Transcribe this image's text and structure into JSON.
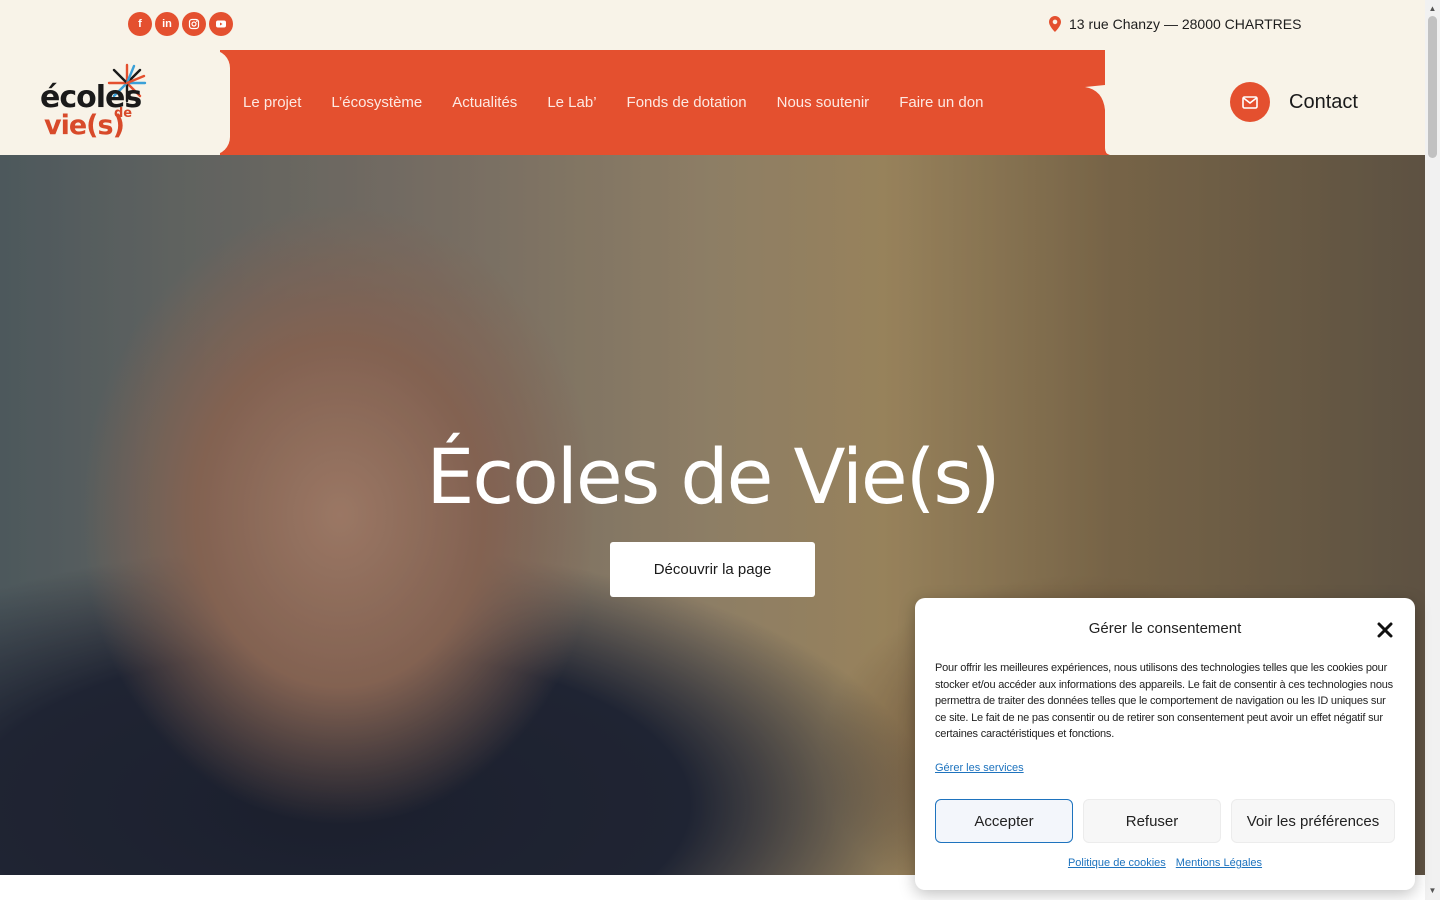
{
  "topbar": {
    "social": [
      {
        "name": "facebook-icon",
        "glyph": "f"
      },
      {
        "name": "linkedin-icon",
        "glyph": "in"
      },
      {
        "name": "instagram-icon",
        "glyph": ""
      },
      {
        "name": "youtube-icon",
        "glyph": ""
      }
    ],
    "address": "13 rue Chanzy — 28000 CHARTRES"
  },
  "logo": {
    "line1": "écoles",
    "line2": "vie(s)",
    "line3": "de"
  },
  "nav": {
    "items": [
      "Le projet",
      "L’écosystème",
      "Actualités",
      "Le Lab’",
      "Fonds de dotation",
      "Nous soutenir",
      "Faire un don"
    ]
  },
  "contact": {
    "label": "Contact"
  },
  "hero": {
    "title": "Écoles de Vie(s)",
    "button": "Découvrir la page"
  },
  "consent": {
    "title": "Gérer le consentement",
    "text": "Pour offrir les meilleures expériences, nous utilisons des technologies telles que les cookies pour stocker et/ou accéder aux informations des appareils. Le fait de consentir à ces technologies nous permettra de traiter des données telles que le comportement de navigation ou les ID uniques sur ce site. Le fait de ne pas consentir ou de retirer son consentement peut avoir un effet négatif sur certaines caractéristiques et fonctions.",
    "manage_link": "Gérer les services",
    "accept": "Accepter",
    "refuse": "Refuser",
    "preferences": "Voir les préférences",
    "cookie_policy": "Politique de cookies",
    "legal": "Mentions Légales"
  },
  "colors": {
    "accent": "#e4502f",
    "cream": "#f8f3e8",
    "link": "#1e73be"
  }
}
